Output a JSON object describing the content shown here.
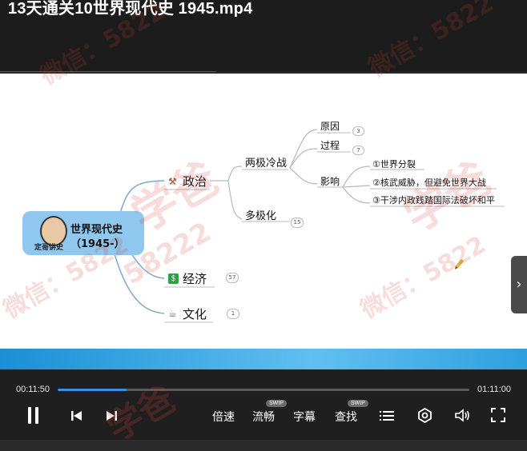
{
  "window": {
    "title": "13天通关10世界现代史 1945.mp4"
  },
  "mindmap": {
    "root": {
      "line1": "世界现代史",
      "line2": "（1945-）",
      "avatar_caption": "定哥讲史"
    },
    "branches": [
      {
        "label": "政治",
        "icon": "gavel-icon"
      },
      {
        "label": "经济",
        "icon": "dollar-icon",
        "badge": "57"
      },
      {
        "label": "文化",
        "icon": "coffee-cup-icon",
        "badge": "1"
      }
    ],
    "politics": [
      {
        "label": "两极冷战"
      },
      {
        "label": "多极化",
        "badge": "15"
      }
    ],
    "coldwar": [
      {
        "label": "原因",
        "badge": "3"
      },
      {
        "label": "过程",
        "badge": "7"
      },
      {
        "label": "影响"
      }
    ],
    "impact": [
      "①世界分裂",
      "②核武威胁，但避免世界大战",
      "③干涉内政践踏国际法破坏和平"
    ]
  },
  "watermarks": {
    "brand": "学爸",
    "wechat": "微信：5822",
    "number": "58222"
  },
  "player": {
    "current_time": "00:11:50",
    "total_time": "01:11:00",
    "progress": 0.167,
    "speed_label": "倍速",
    "quality_label": "流畅",
    "subtitle_label": "字幕",
    "search_label": "查找",
    "swip_badge": "SWIP",
    "accent": "#3a8ee6"
  }
}
